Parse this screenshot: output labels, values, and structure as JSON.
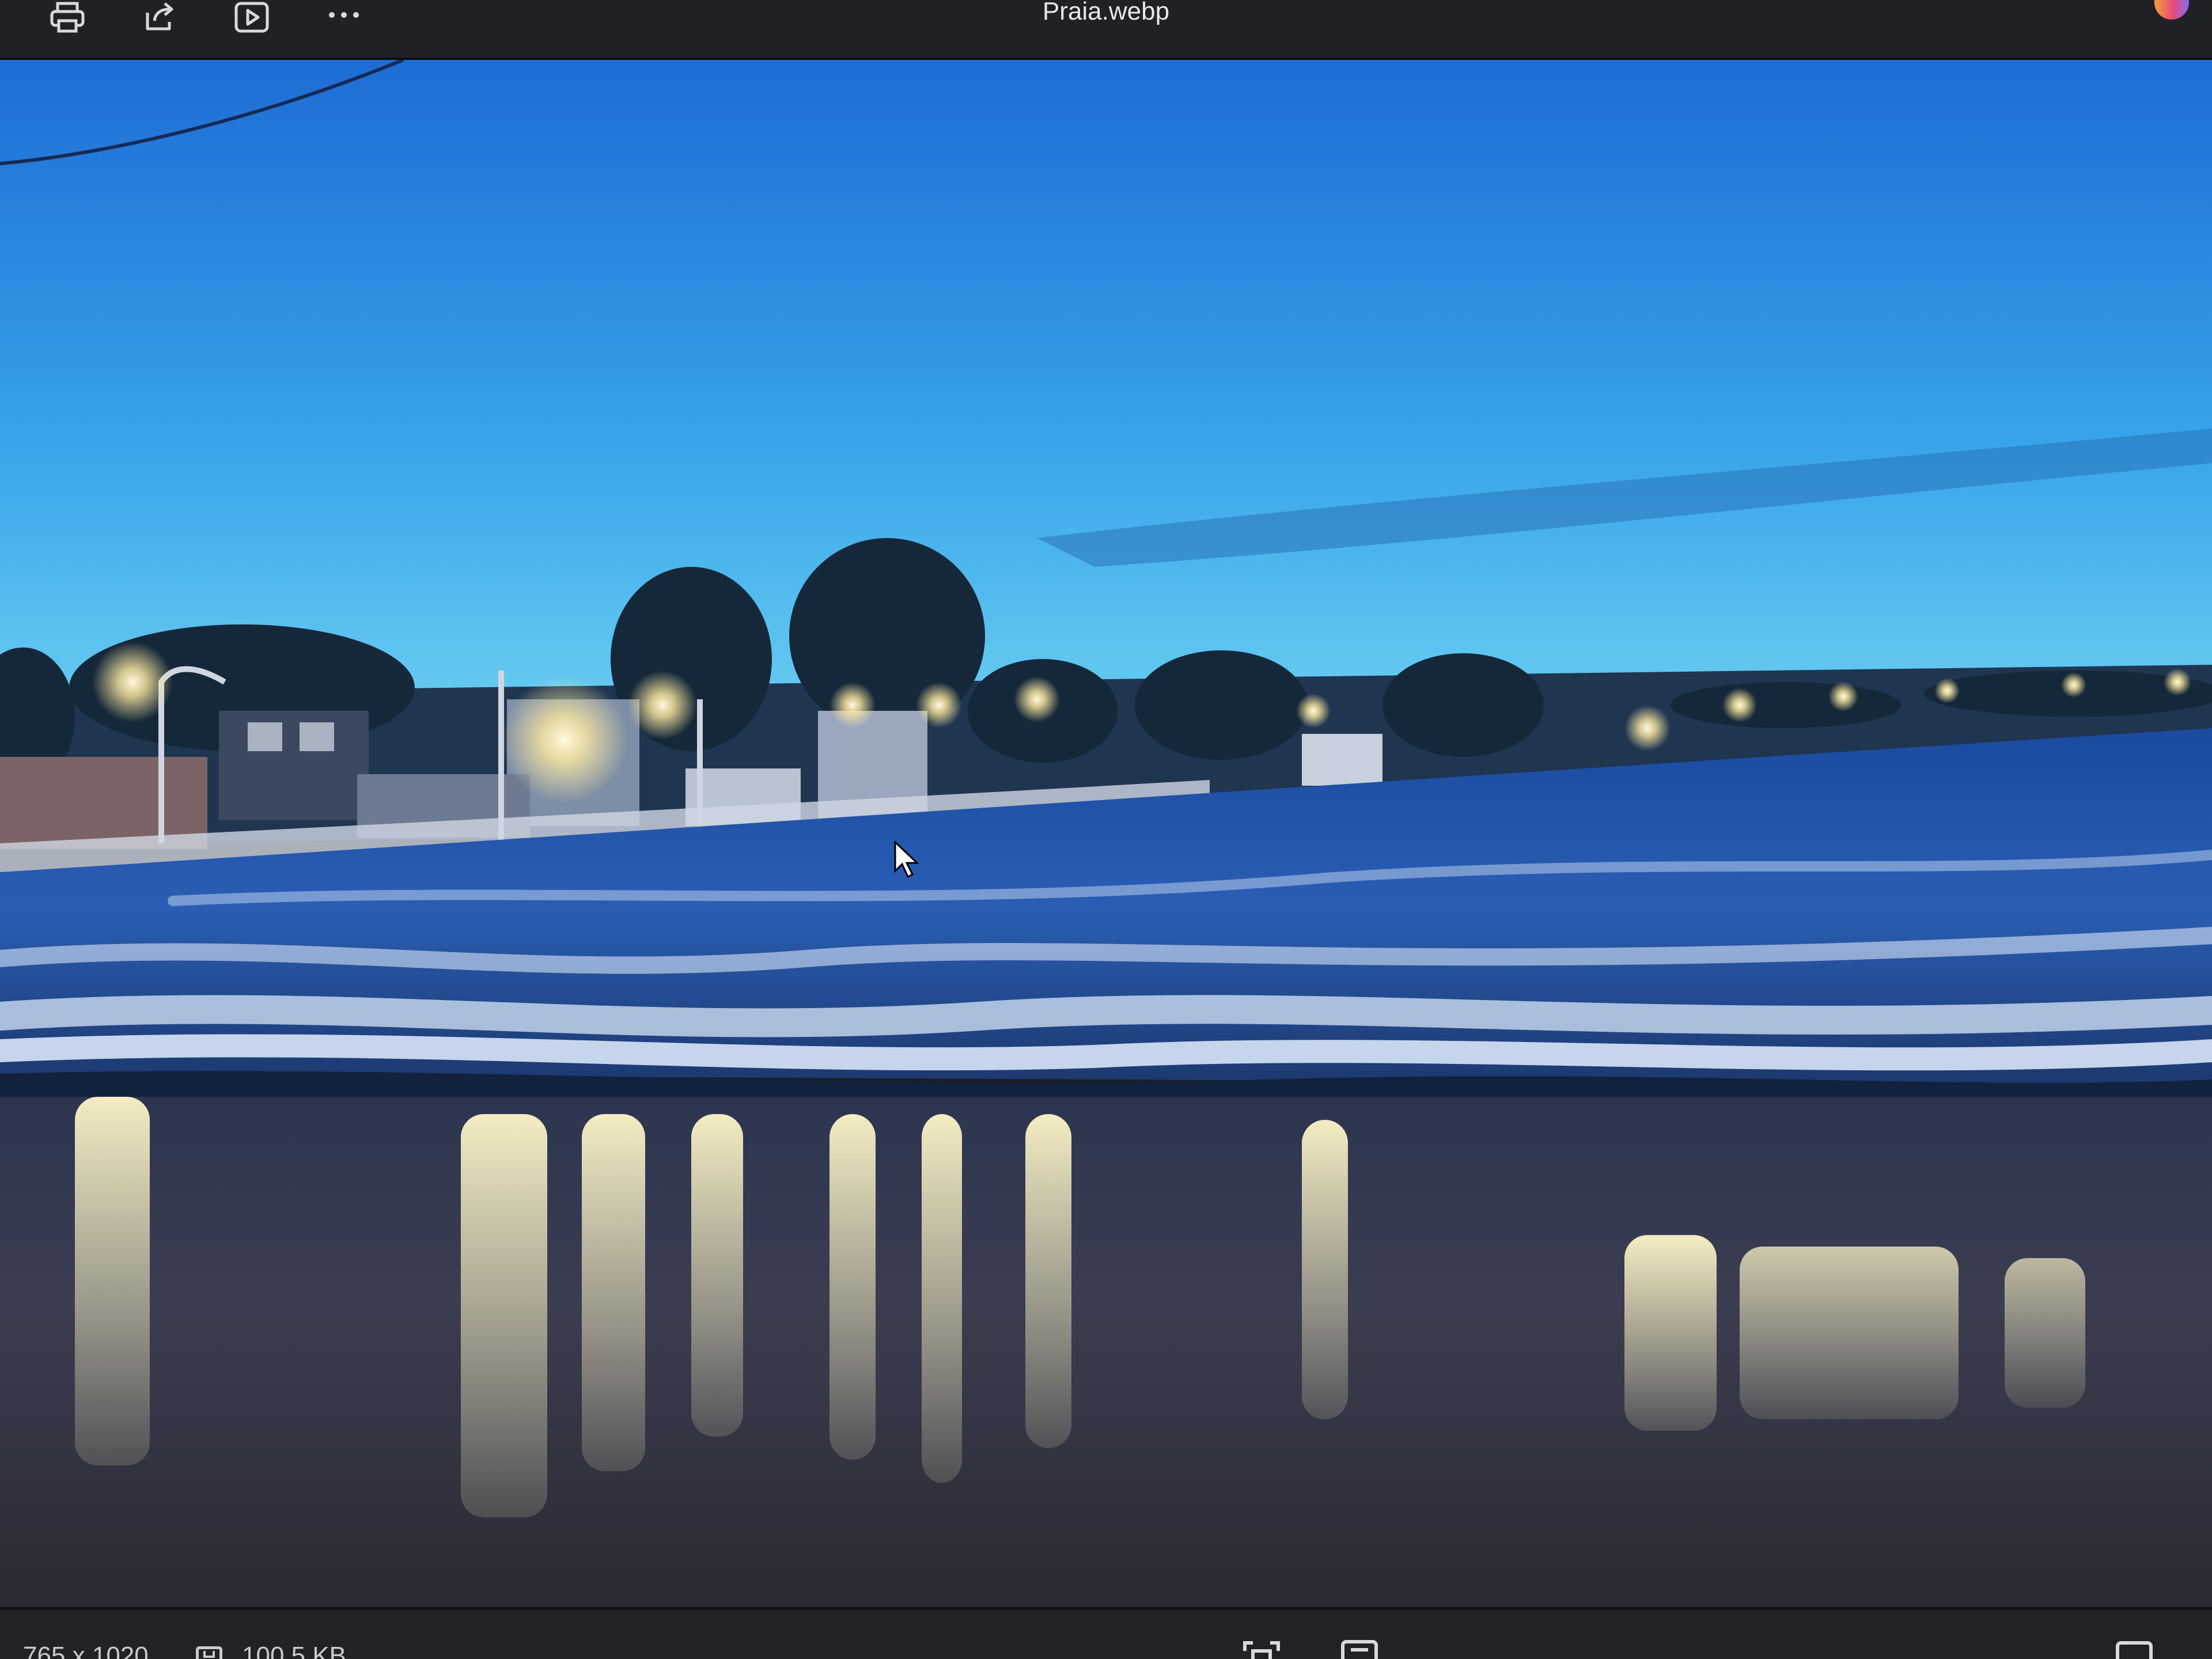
{
  "window": {
    "title": "Praia.webp"
  },
  "toolbar": {
    "buttons": [
      {
        "name": "print",
        "icon": "printer-icon"
      },
      {
        "name": "share",
        "icon": "share-icon"
      },
      {
        "name": "slideshow",
        "icon": "play-icon"
      },
      {
        "name": "more",
        "icon": "more-horizontal-icon"
      }
    ],
    "copilot_icon": "copilot-icon"
  },
  "status": {
    "dimensions": "765 x 1020",
    "file_size": "100.5 KB",
    "disk_icon": "disk-icon"
  },
  "colors": {
    "toolbar_bg": "#1f2126",
    "text": "#e8e8ea",
    "sky_top": "#1f6fd6",
    "sky_bottom": "#5ec4f0",
    "sea": "#1d3f7a",
    "sand": "#3a3b4a"
  }
}
